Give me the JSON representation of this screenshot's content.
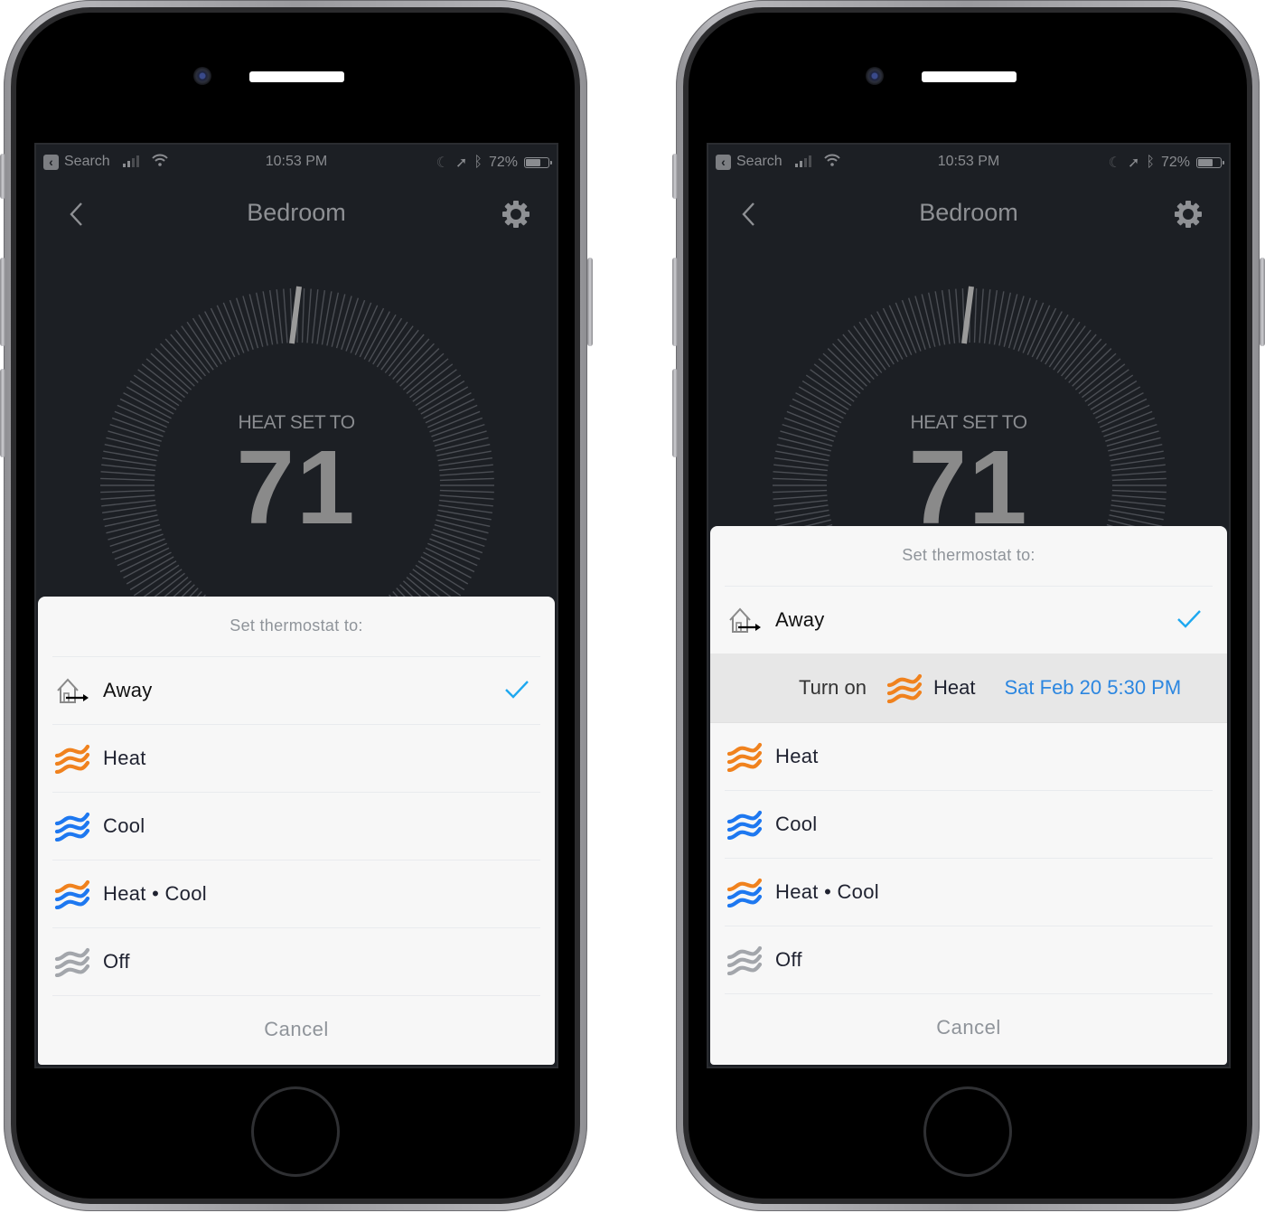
{
  "colors": {
    "heat": "#f0821e",
    "cool": "#1e78f0",
    "off": "#a3a6ab",
    "check": "#1ea8f0",
    "link": "#2b86e0",
    "screen_bg": "#1c1f24"
  },
  "phones": [
    {
      "status_bar": {
        "back_app": "Search",
        "time": "10:53 PM",
        "battery_percent": "72%",
        "battery_level": 0.72,
        "signal_bars": 2,
        "icons": [
          "back-chevron-icon",
          "signal-icon",
          "wifi-icon",
          "moon-icon",
          "location-icon",
          "bluetooth-icon",
          "battery-icon"
        ]
      },
      "nav": {
        "title": "Bedroom",
        "back_icon": "chevron-left-icon",
        "settings_icon": "gear-icon"
      },
      "thermostat": {
        "mode_label": "HEAT SET TO",
        "temperature": "71"
      },
      "sheet": {
        "header": "Set thermostat to:",
        "options": [
          {
            "label": "Away",
            "icon": "away-house-icon",
            "selected": true
          },
          {
            "label": "Heat",
            "icon": "heat-waves-icon",
            "selected": false
          },
          {
            "label": "Cool",
            "icon": "cool-waves-icon",
            "selected": false
          },
          {
            "label": "Heat • Cool",
            "icon": "heat-cool-waves-icon",
            "selected": false
          },
          {
            "label": "Off",
            "icon": "off-waves-icon",
            "selected": false
          }
        ],
        "cancel": "Cancel"
      }
    },
    {
      "status_bar": {
        "back_app": "Search",
        "time": "10:53 PM",
        "battery_percent": "72%",
        "battery_level": 0.72,
        "signal_bars": 2
      },
      "nav": {
        "title": "Bedroom"
      },
      "thermostat": {
        "mode_label": "HEAT SET TO",
        "temperature": "71"
      },
      "sheet": {
        "header": "Set thermostat to:",
        "options": [
          {
            "label": "Away",
            "icon": "away-house-icon",
            "selected": true
          },
          {
            "label": "Heat",
            "icon": "heat-waves-icon",
            "selected": false
          },
          {
            "label": "Cool",
            "icon": "cool-waves-icon",
            "selected": false
          },
          {
            "label": "Heat • Cool",
            "icon": "heat-cool-waves-icon",
            "selected": false
          },
          {
            "label": "Off",
            "icon": "off-waves-icon",
            "selected": false
          }
        ],
        "schedule": {
          "prefix": "Turn on",
          "mode": "Heat",
          "when": "Sat Feb 20 5:30 PM"
        },
        "cancel": "Cancel"
      }
    }
  ]
}
